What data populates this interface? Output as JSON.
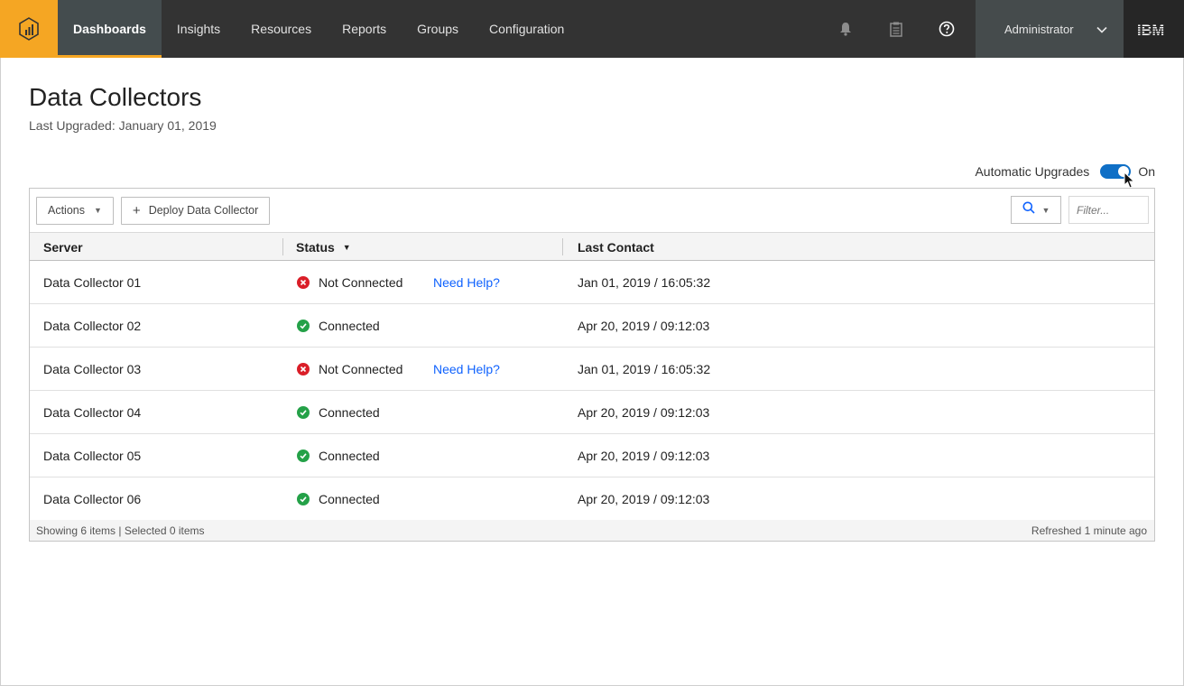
{
  "nav": {
    "items": [
      {
        "label": "Dashboards",
        "active": true
      },
      {
        "label": "Insights",
        "active": false
      },
      {
        "label": "Resources",
        "active": false
      },
      {
        "label": "Reports",
        "active": false
      },
      {
        "label": "Groups",
        "active": false
      },
      {
        "label": "Configuration",
        "active": false
      }
    ],
    "user": "Administrator",
    "brand_logo": "IBM",
    "icons": [
      "bell-icon",
      "clipboard-icon",
      "help-icon"
    ]
  },
  "page": {
    "title": "Data Collectors",
    "subtitle": "Last Upgraded: January 01, 2019"
  },
  "auto_upgrades": {
    "label": "Automatic Upgrades",
    "state": "On"
  },
  "toolbar": {
    "actions_label": "Actions",
    "deploy_label": "Deploy Data Collector",
    "filter_placeholder": "Filter..."
  },
  "table": {
    "columns": {
      "server": "Server",
      "status": "Status",
      "last_contact": "Last Contact"
    },
    "rows": [
      {
        "server": "Data Collector 01",
        "status": "Not Connected",
        "ok": false,
        "help": "Need Help?",
        "last_contact": "Jan 01, 2019 / 16:05:32"
      },
      {
        "server": "Data Collector 02",
        "status": "Connected",
        "ok": true,
        "help": "",
        "last_contact": "Apr 20, 2019 / 09:12:03"
      },
      {
        "server": "Data Collector 03",
        "status": "Not Connected",
        "ok": false,
        "help": "Need Help?",
        "last_contact": "Jan 01, 2019 / 16:05:32"
      },
      {
        "server": "Data Collector 04",
        "status": "Connected",
        "ok": true,
        "help": "",
        "last_contact": "Apr 20, 2019 / 09:12:03"
      },
      {
        "server": "Data Collector 05",
        "status": "Connected",
        "ok": true,
        "help": "",
        "last_contact": "Apr 20, 2019 / 09:12:03"
      },
      {
        "server": "Data Collector 06",
        "status": "Connected",
        "ok": true,
        "help": "",
        "last_contact": "Apr 20, 2019 / 09:12:03"
      }
    ],
    "footer_left": "Showing 6 items | Selected 0 items",
    "footer_right": "Refreshed 1 minute ago"
  },
  "colors": {
    "accent": "#f5a623",
    "nav_bg": "#333333",
    "toggle_on": "#0f6fc6",
    "error": "#da1e28",
    "success": "#24a148",
    "link": "#0f62fe"
  }
}
